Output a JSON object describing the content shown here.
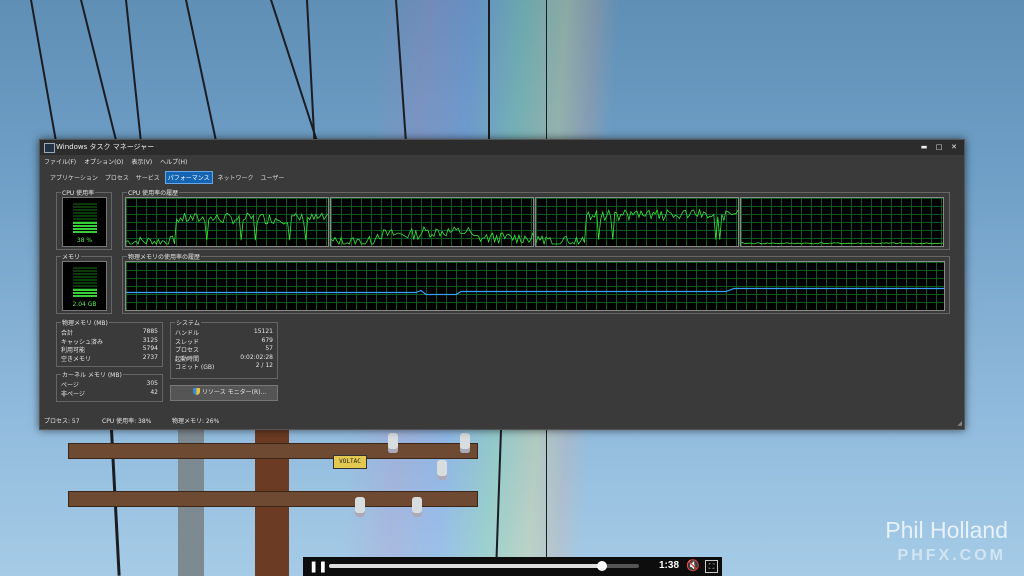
{
  "window": {
    "title": "Windows タスク マネージャー",
    "controls": {
      "minimize": "▬",
      "maximize": "□",
      "close": "✕"
    }
  },
  "menu": [
    "ファイル(F)",
    "オプション(O)",
    "表示(V)",
    "ヘルプ(H)"
  ],
  "tabs": [
    {
      "label": "アプリケーション",
      "active": false
    },
    {
      "label": "プロセス",
      "active": false
    },
    {
      "label": "サービス",
      "active": false
    },
    {
      "label": "パフォーマンス",
      "active": true
    },
    {
      "label": "ネットワーク",
      "active": false
    },
    {
      "label": "ユーザー",
      "active": false
    }
  ],
  "cpu": {
    "group_label": "CPU 使用率",
    "value": "38 %",
    "fraction": 0.38
  },
  "cpu_history": {
    "group_label": "CPU 使用率の履歴",
    "cores": 4
  },
  "memory": {
    "group_label": "メモリ",
    "value": "2.04 GB",
    "fraction": 0.26
  },
  "memory_history": {
    "group_label": "物理メモリの使用率の履歴"
  },
  "physical_memory": {
    "group_label": "物理メモリ (MB)",
    "rows": [
      {
        "label": "合計",
        "value": "7885"
      },
      {
        "label": "キャッシュ済み",
        "value": "3125"
      },
      {
        "label": "利用可能",
        "value": "5794"
      },
      {
        "label": "空きメモリ",
        "value": "2737"
      }
    ]
  },
  "kernel_memory": {
    "group_label": "カーネル メモリ (MB)",
    "rows": [
      {
        "label": "ページ",
        "value": "305"
      },
      {
        "label": "非ページ",
        "value": "42"
      }
    ]
  },
  "system": {
    "group_label": "システム",
    "rows": [
      {
        "label": "ハンドル",
        "value": "15121"
      },
      {
        "label": "スレッド",
        "value": "679"
      },
      {
        "label": "プロセス",
        "value": "57"
      },
      {
        "label": "起動時間",
        "value": "0:02:02:28"
      },
      {
        "label": "コミット (GB)",
        "value": "2 / 12"
      }
    ]
  },
  "resource_monitor_button": "リソース モニター(R)...",
  "statusbar": {
    "processes": "プロセス: 57",
    "cpu": "CPU 使用率: 38%",
    "memory": "物理メモリ: 26%"
  },
  "player": {
    "time": "1:38",
    "progress": 0.88
  },
  "wallpaper": {
    "voltac_label": "VOLTAC",
    "watermark_name": "Phil Holland",
    "watermark_site": "PHFX.COM"
  },
  "colors": {
    "graph_line": "#39e639",
    "graph_grid": "#0c5c20",
    "memory_line": "#3aa0ff",
    "accent_tab": "#1464b4"
  }
}
